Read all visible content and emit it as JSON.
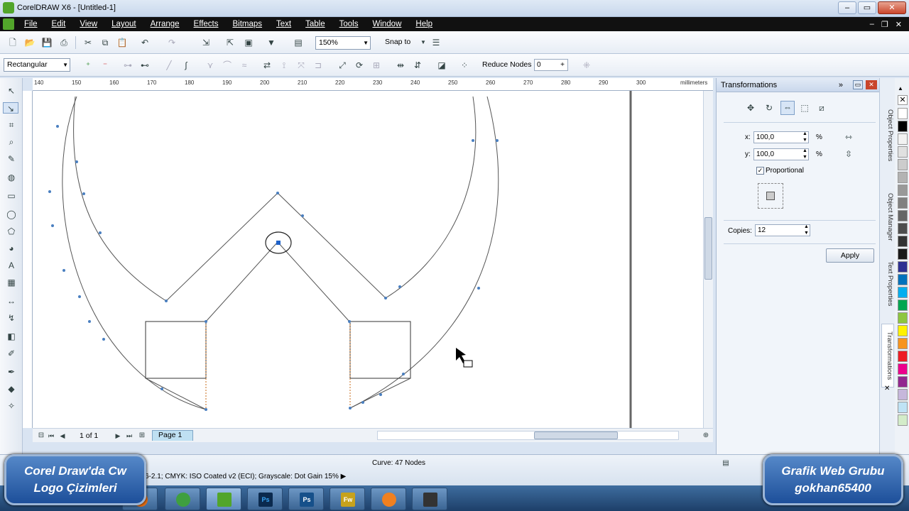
{
  "window": {
    "title": "CorelDRAW X6 - [Untitled-1]"
  },
  "menu": {
    "items": [
      "File",
      "Edit",
      "View",
      "Layout",
      "Arrange",
      "Effects",
      "Bitmaps",
      "Text",
      "Table",
      "Tools",
      "Window",
      "Help"
    ]
  },
  "toolbar": {
    "zoom": "150%",
    "snap_to": "Snap to"
  },
  "propertybar": {
    "selection_mode": "Rectangular",
    "reduce_nodes_label": "Reduce Nodes",
    "reduce_nodes_value": "0"
  },
  "ruler": {
    "unit": "millimeters",
    "ticks": [
      "140",
      "150",
      "160",
      "170",
      "180",
      "190",
      "200",
      "210",
      "220",
      "230",
      "240",
      "250",
      "260",
      "270",
      "280",
      "290",
      "300"
    ]
  },
  "docker": {
    "title": "Transformations",
    "x_label": "x:",
    "x_value": "100,0",
    "x_unit": "%",
    "y_label": "y:",
    "y_value": "100,0",
    "y_unit": "%",
    "proportional_label": "Proportional",
    "copies_label": "Copies:",
    "copies_value": "12",
    "apply_label": "Apply"
  },
  "side_tabs": [
    "Object Properties",
    "Object Manager",
    "Text Properties",
    "Transformations"
  ],
  "page_nav": {
    "counter": "1 of 1",
    "page_tab": "Page 1"
  },
  "status": {
    "curve_info": "Curve: 47 Nodes",
    "color_profile": "6-2.1; CMYK: ISO Coated v2 (ECI); Grayscale: Dot Gain 15% ▶"
  },
  "overlay_left": {
    "line1": "Corel Draw'da Cw",
    "line2": "Logo Çizimleri"
  },
  "overlay_right": {
    "line1": "Grafik Web Grubu",
    "line2": "gokhan65400"
  },
  "taskbar": {
    "ps1": "Ps",
    "ps2": "Ps",
    "fw": "Fw"
  },
  "palette_colors": [
    "#ffffff",
    "#000000",
    "#f2f2f2",
    "#e0e0e0",
    "#cccccc",
    "#b3b3b3",
    "#999999",
    "#808080",
    "#666666",
    "#4d4d4d",
    "#333333",
    "#1a1a1a",
    "#2e3192",
    "#0072bc",
    "#00aeef",
    "#00a651",
    "#8dc63f",
    "#fff200",
    "#f7941d",
    "#ed1c24",
    "#ec008c",
    "#92278f",
    "#c6b7db",
    "#bfe3f5",
    "#d3ecc9"
  ]
}
